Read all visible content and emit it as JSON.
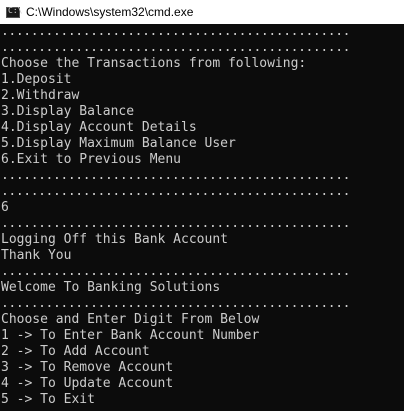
{
  "window": {
    "title": "C:\\Windows\\system32\\cmd.exe",
    "icon": "cmd-icon"
  },
  "console": {
    "lines": [
      "...............................................",
      "...............................................",
      "Choose the Transactions from following:",
      "1.Deposit",
      "2.Withdraw",
      "3.Display Balance",
      "4.Display Account Details",
      "5.Display Maximum Balance User",
      "6.Exit to Previous Menu",
      "...............................................",
      "...............................................",
      "6",
      "...............................................",
      "Logging Off this Bank Account",
      "Thank You",
      "...............................................",
      "Welcome To Banking Solutions",
      "...............................................",
      "Choose and Enter Digit From Below",
      "1 -> To Enter Bank Account Number",
      "2 -> To Add Account",
      "3 -> To Remove Account",
      "4 -> To Update Account",
      "5 -> To Exit",
      "..............................................."
    ]
  }
}
